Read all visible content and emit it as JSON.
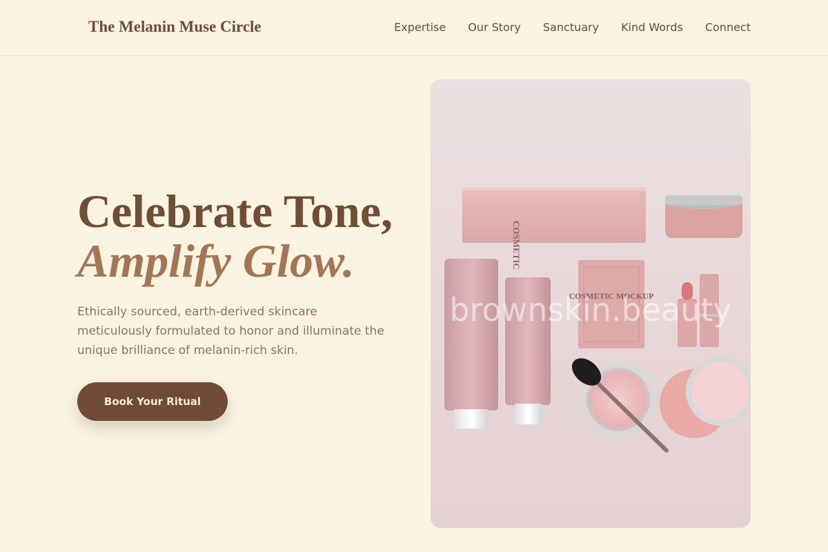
{
  "header": {
    "brand": "The Melanin Muse Circle",
    "nav": [
      "Expertise",
      "Our Story",
      "Sanctuary",
      "Kind Words",
      "Connect"
    ]
  },
  "hero": {
    "title_line1": "Celebrate Tone,",
    "title_line2": "Amplify Glow.",
    "subtitle": "Ethically sourced, earth-derived skincare meticulously formulated to honor and illuminate the unique brilliance of melanin-rich skin.",
    "cta_label": "Book Your Ritual"
  },
  "image": {
    "watermark": "brownskin.beauty",
    "product_text": "COSMETIC MOCKUP"
  },
  "colors": {
    "background": "#fbf3e1",
    "brand_brown": "#6f4d37",
    "accent_italic": "#a37658",
    "button": "#6f4a34",
    "product_pink": "#dcaeb1"
  }
}
